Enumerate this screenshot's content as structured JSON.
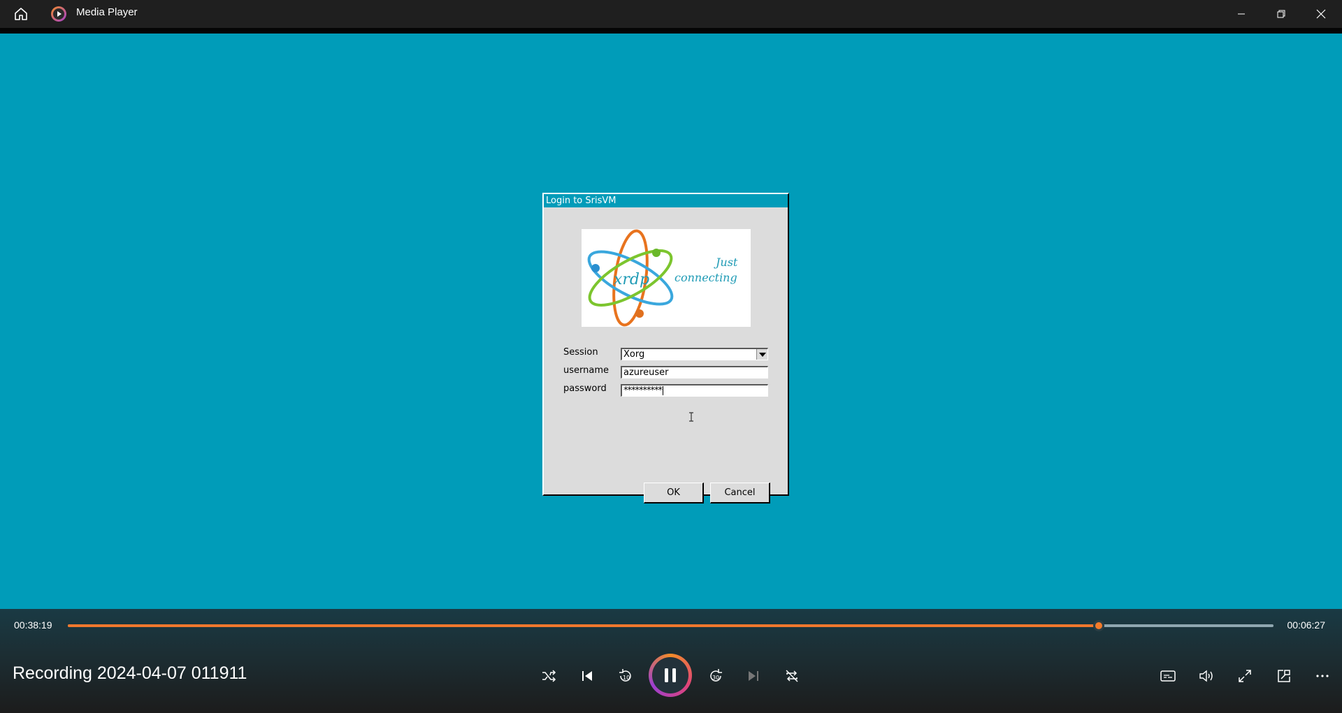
{
  "window": {
    "title": "Media Player",
    "buttons": [
      "minimize",
      "restore",
      "close"
    ]
  },
  "dialog": {
    "title": "Login to SrisVM",
    "logo": {
      "word": "xrdp",
      "tagline_1": "Just",
      "tagline_2": "connecting"
    },
    "fields": {
      "session_label": "Session",
      "session_value": "Xorg",
      "username_label": "username",
      "username_value": "azureuser",
      "password_label": "password",
      "password_value": "**********"
    },
    "ok_label": "OK",
    "cancel_label": "Cancel"
  },
  "player": {
    "elapsed": "00:38:19",
    "remaining": "00:06:27",
    "progress_fraction": 0.855,
    "media_title": "Recording 2024-04-07 011911",
    "accent_color": "#f0782d",
    "video_bg_color": "#009cb9"
  }
}
